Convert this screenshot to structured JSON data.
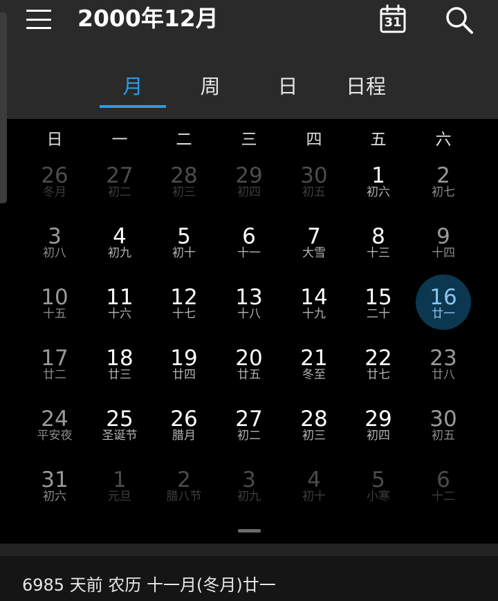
{
  "header": {
    "title": "2000年12月",
    "today_icon_day": "31",
    "menu_icon": "hamburger-menu-icon",
    "today_icon": "calendar-today-icon",
    "search_icon": "search-icon"
  },
  "tabs": [
    {
      "label": "月",
      "active": true
    },
    {
      "label": "周",
      "active": false
    },
    {
      "label": "日",
      "active": false
    },
    {
      "label": "日程",
      "active": false
    }
  ],
  "weekdays": [
    "日",
    "一",
    "二",
    "三",
    "四",
    "五",
    "六"
  ],
  "weeks": [
    [
      {
        "day": "26",
        "lunar": "冬月",
        "adjacent": true
      },
      {
        "day": "27",
        "lunar": "初二",
        "adjacent": true
      },
      {
        "day": "28",
        "lunar": "初三",
        "adjacent": true
      },
      {
        "day": "29",
        "lunar": "初四",
        "adjacent": true
      },
      {
        "day": "30",
        "lunar": "初五",
        "adjacent": true
      },
      {
        "day": "1",
        "lunar": "初六"
      },
      {
        "day": "2",
        "lunar": "初七"
      }
    ],
    [
      {
        "day": "3",
        "lunar": "初八"
      },
      {
        "day": "4",
        "lunar": "初九"
      },
      {
        "day": "5",
        "lunar": "初十"
      },
      {
        "day": "6",
        "lunar": "十一"
      },
      {
        "day": "7",
        "lunar": "大雪"
      },
      {
        "day": "8",
        "lunar": "十三"
      },
      {
        "day": "9",
        "lunar": "十四"
      }
    ],
    [
      {
        "day": "10",
        "lunar": "十五"
      },
      {
        "day": "11",
        "lunar": "十六"
      },
      {
        "day": "12",
        "lunar": "十七"
      },
      {
        "day": "13",
        "lunar": "十八"
      },
      {
        "day": "14",
        "lunar": "十九"
      },
      {
        "day": "15",
        "lunar": "二十"
      },
      {
        "day": "16",
        "lunar": "廿一",
        "today": true
      }
    ],
    [
      {
        "day": "17",
        "lunar": "廿二"
      },
      {
        "day": "18",
        "lunar": "廿三"
      },
      {
        "day": "19",
        "lunar": "廿四"
      },
      {
        "day": "20",
        "lunar": "廿五"
      },
      {
        "day": "21",
        "lunar": "冬至"
      },
      {
        "day": "22",
        "lunar": "廿七"
      },
      {
        "day": "23",
        "lunar": "廿八"
      }
    ],
    [
      {
        "day": "24",
        "lunar": "平安夜"
      },
      {
        "day": "25",
        "lunar": "圣诞节"
      },
      {
        "day": "26",
        "lunar": "腊月"
      },
      {
        "day": "27",
        "lunar": "初二"
      },
      {
        "day": "28",
        "lunar": "初三"
      },
      {
        "day": "29",
        "lunar": "初四"
      },
      {
        "day": "30",
        "lunar": "初五"
      }
    ],
    [
      {
        "day": "31",
        "lunar": "初六"
      },
      {
        "day": "1",
        "lunar": "元旦",
        "adjacent": true
      },
      {
        "day": "2",
        "lunar": "腊八节",
        "adjacent": true
      },
      {
        "day": "3",
        "lunar": "初九",
        "adjacent": true
      },
      {
        "day": "4",
        "lunar": "初十",
        "adjacent": true
      },
      {
        "day": "5",
        "lunar": "小寒",
        "adjacent": true
      },
      {
        "day": "6",
        "lunar": "十二",
        "adjacent": true
      }
    ]
  ],
  "footer": {
    "info": "6985 天前  农历 十一月(冬月)廿一"
  },
  "colors": {
    "accent": "#2f9be6",
    "today_highlight": "#0c3750",
    "header_bg": "#2a2a2a"
  }
}
